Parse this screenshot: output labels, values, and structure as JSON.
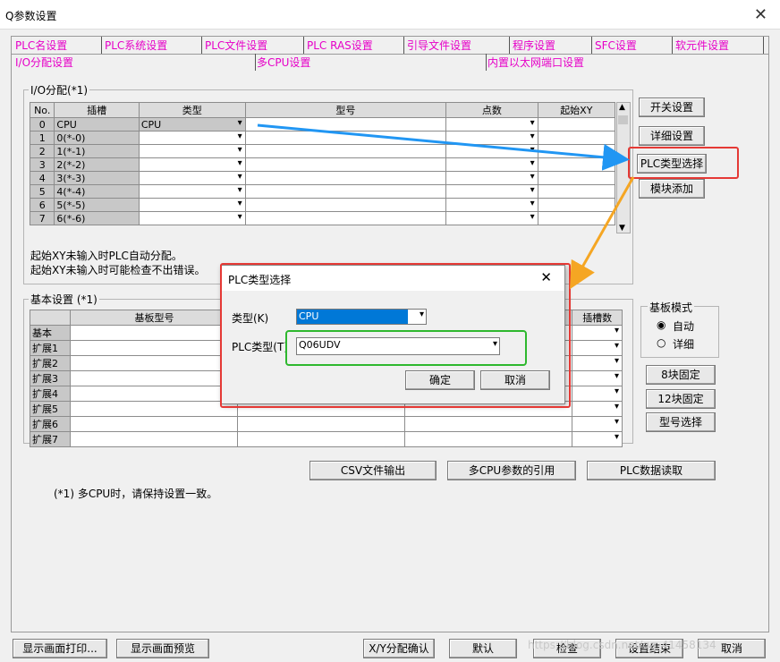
{
  "window": {
    "title": "Q参数设置"
  },
  "tabs_row1": [
    "PLC名设置",
    "PLC系统设置",
    "PLC文件设置",
    "PLC RAS设置",
    "引导文件设置",
    "程序设置",
    "SFC设置",
    "软元件设置"
  ],
  "tabs_row2": [
    "I/O分配设置",
    "多CPU设置",
    "内置以太网端口设置"
  ],
  "io": {
    "group_title": "I/O分配(*1)",
    "headers": [
      "No.",
      "插槽",
      "类型",
      "型号",
      "点数",
      "起始XY"
    ],
    "rows": [
      {
        "no": "0",
        "slot": "CPU",
        "type": "CPU"
      },
      {
        "no": "1",
        "slot": "0(*-0)",
        "type": ""
      },
      {
        "no": "2",
        "slot": "1(*-1)",
        "type": ""
      },
      {
        "no": "3",
        "slot": "2(*-2)",
        "type": ""
      },
      {
        "no": "4",
        "slot": "3(*-3)",
        "type": ""
      },
      {
        "no": "5",
        "slot": "4(*-4)",
        "type": ""
      },
      {
        "no": "6",
        "slot": "5(*-5)",
        "type": ""
      },
      {
        "no": "7",
        "slot": "6(*-6)",
        "type": ""
      }
    ],
    "note1": "起始XY未输入时PLC自动分配。",
    "note2": "起始XY未输入时可能检查不出错误。",
    "btn_switch": "开关设置",
    "btn_detail": "详细设置",
    "btn_plc_type": "PLC类型选择",
    "btn_add_module": "模块添加"
  },
  "base": {
    "group_title": "基本设置 (*1)",
    "headers": [
      "基板型号",
      "插槽数"
    ],
    "rows": [
      "基本",
      "扩展1",
      "扩展2",
      "扩展3",
      "扩展4",
      "扩展5",
      "扩展6",
      "扩展7"
    ],
    "mode_title": "基板模式",
    "mode_auto": "自动",
    "mode_detail": "详细",
    "btn_8": "8块固定",
    "btn_12": "12块固定",
    "btn_model": "型号选择"
  },
  "mid_buttons": {
    "csv": "CSV文件输出",
    "multi_cpu": "多CPU参数的引用",
    "plc_read": "PLC数据读取"
  },
  "footnote": "(*1) 多CPU时，请保持设置一致。",
  "bottom_buttons": {
    "print": "显示画面打印...",
    "preview": "显示画面预览",
    "xy_confirm": "X/Y分配确认",
    "default": "默认",
    "check": "检查",
    "finish": "设置结束",
    "cancel": "取消"
  },
  "watermark": "https://blog.csdn.net/qq_41458134",
  "dialog": {
    "title": "PLC类型选择",
    "type_label": "类型(K)",
    "type_value": "CPU",
    "plc_type_label": "PLC类型(T)",
    "plc_type_value": "Q06UDV",
    "ok": "确定",
    "cancel": "取消"
  },
  "colors": {
    "accent_red": "#e53935",
    "accent_green": "#2eb82e",
    "arrow_blue": "#2196f3",
    "arrow_orange": "#f5a623",
    "tab_pink": "#e600c8"
  }
}
